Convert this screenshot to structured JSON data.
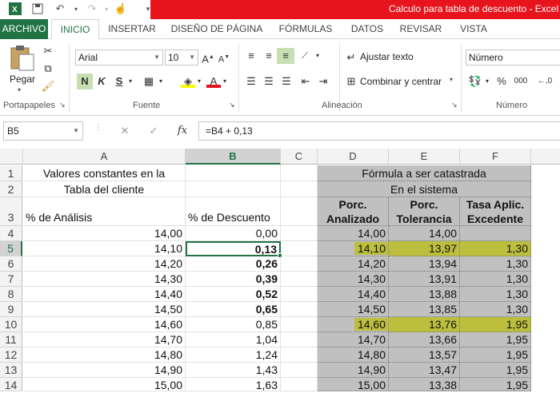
{
  "window": {
    "title": "Calculo para tabla de descuento -  Excel"
  },
  "tabs": [
    "ARCHIVO",
    "INICIO",
    "INSERTAR",
    "DISEÑO DE PÁGINA",
    "FÓRMULAS",
    "DATOS",
    "REVISAR",
    "VISTA"
  ],
  "ribbon": {
    "paste_label": "Pegar",
    "font_name": "Arial",
    "font_size": "10",
    "bold": "N",
    "italic": "K",
    "underline": "S",
    "wrap_text": "Ajustar texto",
    "merge_center": "Combinar y centrar",
    "number_format": "Número",
    "groups": {
      "clipboard": "Portapapeles",
      "font": "Fuente",
      "alignment": "Alineación",
      "number": "Número"
    }
  },
  "formula_bar": {
    "name_box": "B5",
    "formula": "=B4 + 0,13",
    "fx": "fx"
  },
  "columns": [
    "A",
    "B",
    "C",
    "D",
    "E",
    "F"
  ],
  "rows": [
    "1",
    "2",
    "3",
    "4",
    "5",
    "6",
    "7",
    "8",
    "9",
    "10",
    "11",
    "12",
    "13",
    "14"
  ],
  "sheet": {
    "a1": "Valores constantes en la",
    "a2": "Tabla del cliente",
    "a3": "% de Análisis",
    "b3": "% de Descuento",
    "d1": "Fórmula a ser catastrada",
    "d2": "En el sistema",
    "d3": [
      "Porc.",
      "Analizado"
    ],
    "e3": [
      "Porc.",
      "Tolerancia"
    ],
    "f3": [
      "Tasa Aplic.",
      "Excedente"
    ],
    "data": [
      {
        "a": "14,00",
        "b": "0,00",
        "d": "14,00",
        "e": "14,00",
        "f": ""
      },
      {
        "a": "14,10",
        "b": "0,13",
        "d": "14,10",
        "e": "13,97",
        "f": "1,30"
      },
      {
        "a": "14,20",
        "b": "0,26",
        "d": "14,20",
        "e": "13,94",
        "f": "1,30"
      },
      {
        "a": "14,30",
        "b": "0,39",
        "d": "14,30",
        "e": "13,91",
        "f": "1,30"
      },
      {
        "a": "14,40",
        "b": "0,52",
        "d": "14,40",
        "e": "13,88",
        "f": "1,30"
      },
      {
        "a": "14,50",
        "b": "0,65",
        "d": "14,50",
        "e": "13,85",
        "f": "1,30"
      },
      {
        "a": "14,60",
        "b": "0,85",
        "d": "14,60",
        "e": "13,76",
        "f": "1,95"
      },
      {
        "a": "14,70",
        "b": "1,04",
        "d": "14,70",
        "e": "13,66",
        "f": "1,95"
      },
      {
        "a": "14,80",
        "b": "1,24",
        "d": "14,80",
        "e": "13,57",
        "f": "1,95"
      },
      {
        "a": "14,90",
        "b": "1,43",
        "d": "14,90",
        "e": "13,47",
        "f": "1,95"
      },
      {
        "a": "15,00",
        "b": "1,63",
        "d": "15,00",
        "e": "13,38",
        "f": "1,95"
      }
    ]
  }
}
